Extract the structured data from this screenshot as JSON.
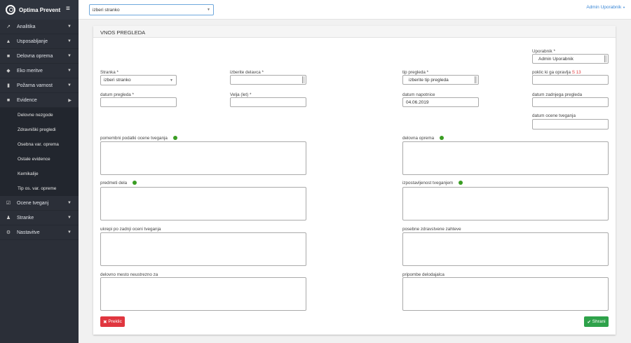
{
  "brand": "Optima Prevent",
  "top": {
    "client_select": "izberi stranko",
    "user_menu": "Admin Uporabnik"
  },
  "nav": [
    {
      "label": "Analitika",
      "icon": "chart-icon"
    },
    {
      "label": "Usposabljanje",
      "icon": "graduation-cap-icon"
    },
    {
      "label": "Delovna oprema",
      "icon": "truck-icon"
    },
    {
      "label": "Eko meritve",
      "icon": "leaf-icon"
    },
    {
      "label": "Požarna varnost",
      "icon": "fire-extinguisher-icon"
    },
    {
      "label": "Evidence",
      "icon": "folder-icon"
    }
  ],
  "sub": [
    "Delovne nezgode",
    "Zdravniški pregledi",
    "Osebna var. oprema",
    "Ostale evidence",
    "Kemikalije",
    "Tip os. var. opreme"
  ],
  "nav2": [
    {
      "label": "Ocene tveganj",
      "icon": "check-square-icon"
    },
    {
      "label": "Stranke",
      "icon": "user-icon"
    },
    {
      "label": "Nastavitve",
      "icon": "cogs-icon"
    }
  ],
  "panel": {
    "title": "VNOS PREGLEDA"
  },
  "form": {
    "uporabnik_label": "Uporabnik *",
    "uporabnik_value": "Admin Uporabnik",
    "stranka_label": "Stranka *",
    "stranka_value": "izberi stranko",
    "delavec_label": "izberite delavca *",
    "delavec_value": "",
    "tip_label": "tip pregleda *",
    "tip_value": "izberite tip pregleda",
    "poklic_label": "poklic ki ga opravlja",
    "poklic_code": "S 13",
    "datum_pregleda_label": "datum pregleda *",
    "velja_label": "Velja (let) *",
    "datum_napotnice_label": "datum napotnice",
    "datum_napotnice_value": "04.06.2019",
    "datum_zadnjega_label": "datum zadnjega pregleda",
    "datum_ocene_label": "datum ocene tveganja",
    "pomembni_label": "pomembni podatki ocene tveganja",
    "oprema_label": "delovna oprema",
    "predmeti_label": "predmeti dela",
    "izpostavljenost_label": "izpostavljenost tveganjem",
    "ukrepi_label": "ukrepi po zadnji oceni tveganja",
    "zahteve_label": "posebne zdravstvene zahteve",
    "neustrezno_label": "delovno mesto neustrezno za",
    "pripombe_label": "pripombe delodajalca"
  },
  "buttons": {
    "cancel": "Preklic",
    "save": "Shrani"
  }
}
